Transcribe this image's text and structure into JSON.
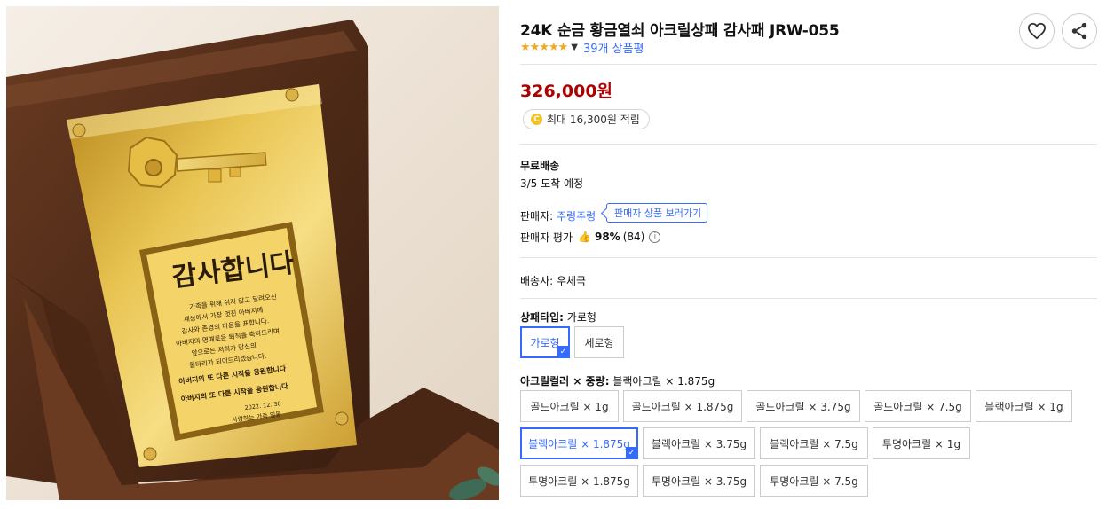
{
  "product": {
    "title": "24K 순금 황금열쇠 아크릴상패 감사패 JRW-055",
    "stars": "★★★★★",
    "review_count": "39개 상품평",
    "price": "326,000원",
    "reward": "최대 16,300원 적립",
    "reward_coin": "C"
  },
  "plaque": {
    "headline": "감사합니다",
    "lines": [
      "가족을 위해 쉬지 않고 달려오신",
      "세상에서 가장 멋진 아버지께",
      "감사와 존경의 마음을 표합니다.",
      "아버지의 명예로운 퇴직을 축하드리며",
      "앞으로는 저희가 당신의",
      "울타리가 되어드리겠습니다."
    ],
    "emphasis1": "아버지의 또 다른 시작을 응원합니다",
    "emphasis2": "아버지의 또 다른 시작을 응원합니다",
    "date": "2022. 12. 30",
    "signature": "사랑하는 가족 일동"
  },
  "shipping": {
    "label": "무료배송",
    "eta": "3/5 도착 예정"
  },
  "seller": {
    "prefix": "판매자: ",
    "name": "주렁주렁",
    "tag": "판매자 상품 보러가기",
    "eval_label": "판매자 평가",
    "eval_pct": "98%",
    "eval_count": "(84)",
    "info_icon": "i"
  },
  "delivery": {
    "label": "배송사: 우체국"
  },
  "options": {
    "type_label": "상패타입:",
    "type_value": "가로형",
    "types": [
      "가로형",
      "세로형"
    ],
    "color_label": "아크릴컬러 × 중량:",
    "color_value": "블랙아크릴 × 1.875g",
    "colors": [
      "골드아크릴 × 1g",
      "골드아크릴 × 1.875g",
      "골드아크릴 × 3.75g",
      "골드아크릴 × 7.5g",
      "블랙아크릴 × 1g",
      "블랙아크릴 × 1.875g",
      "블랙아크릴 × 3.75g",
      "블랙아크릴 × 7.5g",
      "투명아크릴 × 1g",
      "투명아크릴 × 1.875g",
      "투명아크릴 × 3.75g",
      "투명아크릴 × 7.5g"
    ],
    "check_glyph": "✓"
  },
  "colors": {
    "accent": "#346aff",
    "price": "#ae0000",
    "star": "#f5a623"
  }
}
